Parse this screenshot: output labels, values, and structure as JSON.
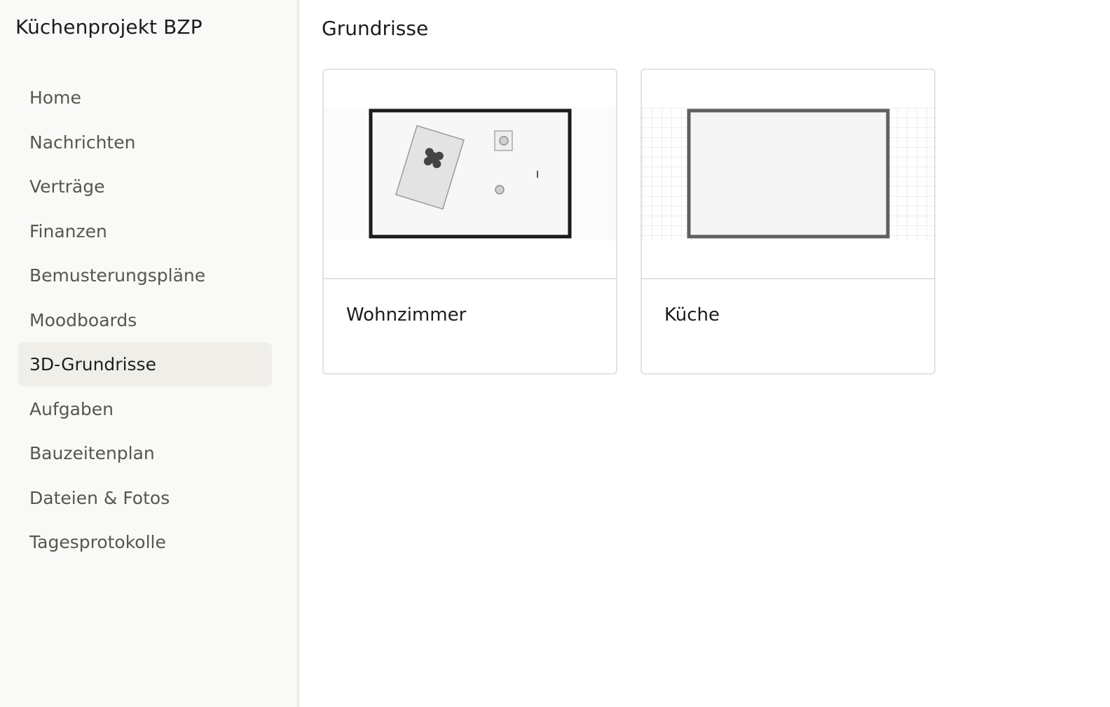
{
  "sidebar": {
    "project_title": "Küchenprojekt BZP",
    "items": [
      {
        "label": "Home",
        "active": false
      },
      {
        "label": "Nachrichten",
        "active": false
      },
      {
        "label": "Verträge",
        "active": false
      },
      {
        "label": "Finanzen",
        "active": false
      },
      {
        "label": "Bemusterungspläne",
        "active": false
      },
      {
        "label": "Moodboards",
        "active": false
      },
      {
        "label": "3D-Grundrisse",
        "active": true
      },
      {
        "label": "Aufgaben",
        "active": false
      },
      {
        "label": "Bauzeitenplan",
        "active": false
      },
      {
        "label": "Dateien & Fotos",
        "active": false
      },
      {
        "label": "Tagesprotokolle",
        "active": false
      }
    ]
  },
  "main": {
    "title": "Grundrisse",
    "floorplans": [
      {
        "name": "Wohnzimmer",
        "preview": "floorplan-with-furniture"
      },
      {
        "name": "Küche",
        "preview": "empty-floorplan-grid"
      }
    ]
  },
  "colors": {
    "sidebar_bg": "#f9f9f7",
    "active_bg": "#efeee9",
    "border": "#e3e2dd"
  }
}
